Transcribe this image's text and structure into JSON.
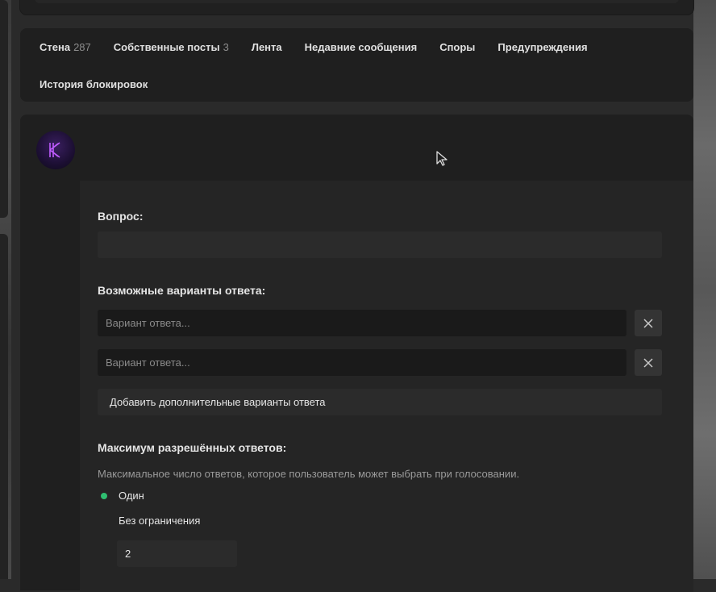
{
  "tabs": [
    {
      "label": "Стена",
      "count": "287"
    },
    {
      "label": "Собственные посты",
      "count": "3"
    },
    {
      "label": "Лента",
      "count": ""
    },
    {
      "label": "Недавние сообщения",
      "count": ""
    },
    {
      "label": "Споры",
      "count": ""
    },
    {
      "label": "Предупреждения",
      "count": ""
    },
    {
      "label": "История блокировок",
      "count": ""
    }
  ],
  "avatar": {
    "letter": "K",
    "accent": "#b14cff"
  },
  "form": {
    "question_label": "Вопрос:",
    "question_value": "",
    "options_label": "Возможные варианты ответа:",
    "option_placeholder": "Вариант ответа...",
    "options": [
      "",
      ""
    ],
    "add_options_label": "Добавить дополнительные варианты ответа",
    "max_answers_label": "Максимум разрешённых ответов:",
    "max_answers_hint": "Максимальное число ответов, которое пользователь может выбрать при голосовании.",
    "radio_one": "Один",
    "radio_unlimited": "Без ограничения",
    "limit_value": "2"
  },
  "colors": {
    "accent_green": "#2fbf71",
    "panel": "#1f1f1f"
  }
}
